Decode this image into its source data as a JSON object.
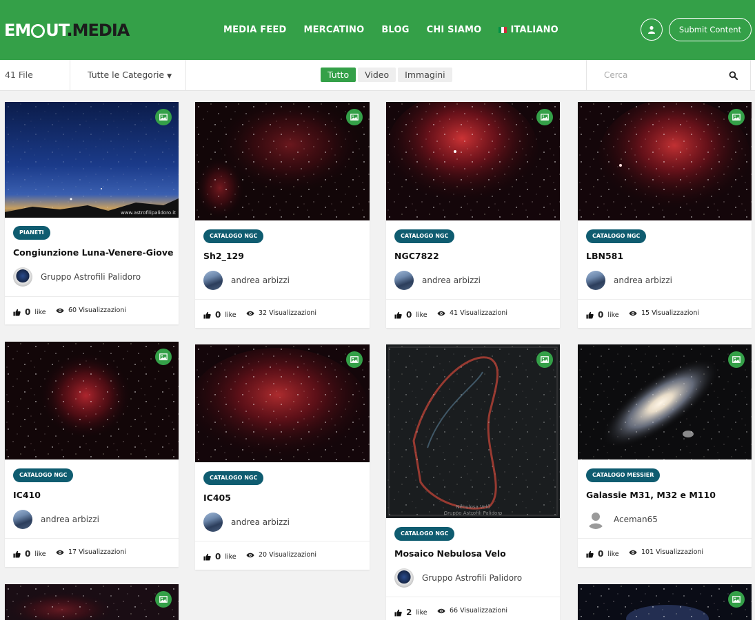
{
  "header": {
    "logo": {
      "part1": "EM",
      "part2": "UT",
      "part3": ".MEDIA"
    },
    "nav": [
      {
        "label": "MEDIA FEED"
      },
      {
        "label": "MERCATINO"
      },
      {
        "label": "BLOG"
      },
      {
        "label": "CHI SIAMO"
      },
      {
        "label": "ITALIANO",
        "icon": "italy-flag-icon"
      }
    ],
    "submit_label": "Submit Content",
    "user_icon": "user-icon",
    "brand_color": "#34a048"
  },
  "filters": {
    "file_count": "41 File",
    "category_label": "Tutte le Categorie",
    "tabs": [
      {
        "label": "Tutto",
        "active": true
      },
      {
        "label": "Video",
        "active": false
      },
      {
        "label": "Immagini",
        "active": false
      }
    ],
    "search_placeholder": "Cerca"
  },
  "cards": [
    {
      "category": "PIANETI",
      "title": "Congiunzione Luna-Venere-Giove",
      "author": "Gruppo Astrofili Palidoro",
      "likes": "0",
      "likes_label": "like",
      "views": "60 Visualizzazioni",
      "watermark": "www.astrofilipalidoro.it"
    },
    {
      "category": "CATALOGO NGC",
      "title": "Sh2_129",
      "author": "andrea arbizzi",
      "likes": "0",
      "likes_label": "like",
      "views": "32 Visualizzazioni"
    },
    {
      "category": "CATALOGO NGC",
      "title": "NGC7822",
      "author": "andrea arbizzi",
      "likes": "0",
      "likes_label": "like",
      "views": "41 Visualizzazioni"
    },
    {
      "category": "CATALOGO NGC",
      "title": "LBN581",
      "author": "andrea arbizzi",
      "likes": "0",
      "likes_label": "like",
      "views": "15 Visualizzazioni"
    },
    {
      "category": "CATALOGO NGC",
      "title": "IC410",
      "author": "andrea arbizzi",
      "likes": "0",
      "likes_label": "like",
      "views": "17 Visualizzazioni"
    },
    {
      "category": "CATALOGO NGC",
      "title": "IC405",
      "author": "andrea arbizzi",
      "likes": "0",
      "likes_label": "like",
      "views": "20 Visualizzazioni"
    },
    {
      "category": "CATALOGO NGC",
      "title": "Mosaico Nebulosa Velo",
      "author": "Gruppo Astrofili Palidoro",
      "likes": "2",
      "likes_label": "like",
      "views": "66 Visualizzazioni",
      "image_caption_1": "Nebulosa Velo",
      "image_caption_2": "Gruppo Astrofili Palidoro"
    },
    {
      "category": "CATALOGO MESSIER",
      "title": "Galassie M31, M32 e M110",
      "author": "Aceman65",
      "likes": "0",
      "likes_label": "like",
      "views": "101 Visualizzazioni"
    }
  ]
}
